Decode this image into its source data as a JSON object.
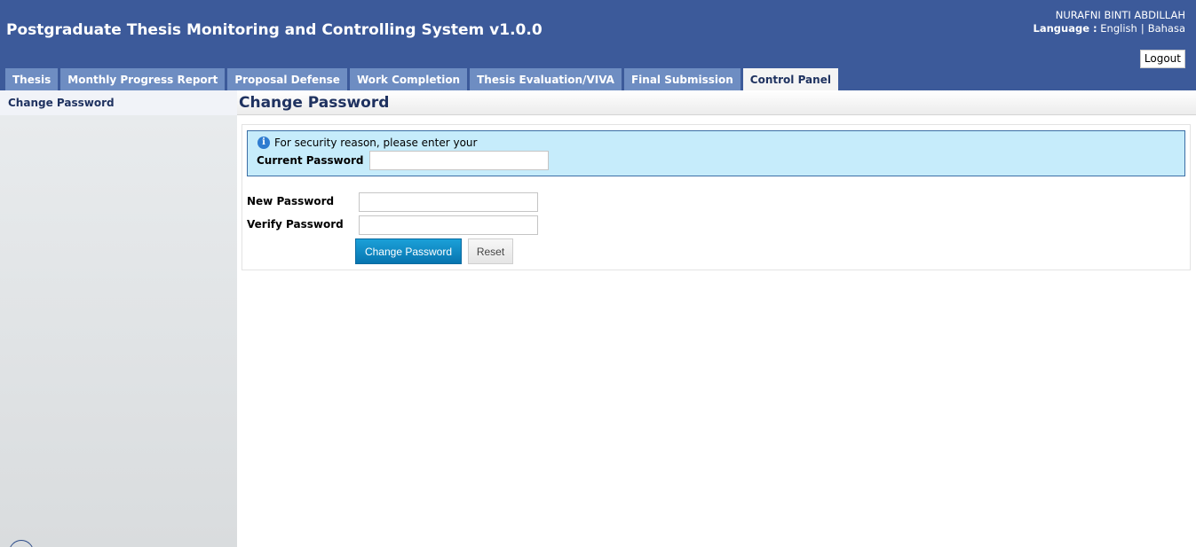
{
  "app": {
    "title": "Postgraduate Thesis Monitoring and Controlling System v1.0.0"
  },
  "user": {
    "name": "NURAFNI BINTI ABDILLAH",
    "language_label": "Language :",
    "languages": [
      "English",
      "Bahasa"
    ],
    "separator": "|",
    "logout_label": "Logout"
  },
  "tabs": [
    {
      "label": "Thesis"
    },
    {
      "label": "Monthly Progress Report"
    },
    {
      "label": "Proposal Defense"
    },
    {
      "label": "Work Completion"
    },
    {
      "label": "Thesis Evaluation/VIVA"
    },
    {
      "label": "Final Submission"
    },
    {
      "label": "Control Panel",
      "active": true
    }
  ],
  "sidebar": {
    "items": [
      {
        "label": "Change Password"
      }
    ]
  },
  "main": {
    "title": "Change Password",
    "info_icon": "info-icon",
    "info_text": "For security reason, please enter your",
    "current_password_label": "Current Password",
    "current_password_value": "",
    "new_password_label": "New Password",
    "new_password_value": "",
    "verify_password_label": "Verify Password",
    "verify_password_value": "",
    "submit_label": "Change Password",
    "reset_label": "Reset"
  },
  "colors": {
    "header": "#3c5a9a",
    "tab": "#6e8dc2",
    "tab_active": "#f4f4f4",
    "info_box": "#c6ecfb",
    "primary_button": "#0e8ac6"
  }
}
